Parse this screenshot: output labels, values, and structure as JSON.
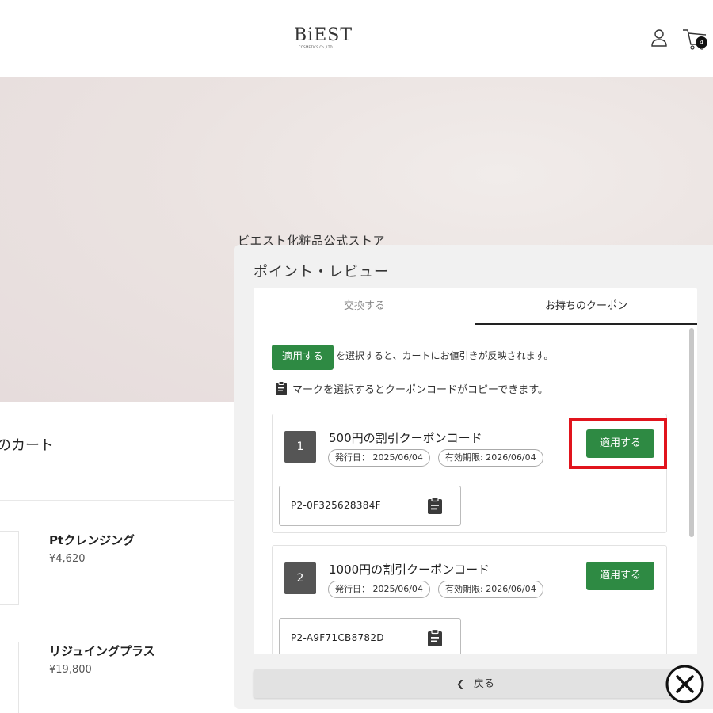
{
  "header": {
    "logo_text": "BiEST",
    "logo_subtext": "COSMETICS Co.,LTD.",
    "cart_count": "4"
  },
  "hero": {
    "shop_title": "ビエスト化粧品公式ストア"
  },
  "cart": {
    "title": "のカート",
    "items": [
      {
        "name": "Ptクレンジング",
        "price": "¥4,620"
      },
      {
        "name": "リジュイングプラス",
        "price": "¥19,800"
      }
    ]
  },
  "panel": {
    "title": "ポイント・レビュー",
    "tabs": [
      {
        "label": "交換する",
        "active": false
      },
      {
        "label": "お持ちのクーポン",
        "active": true
      }
    ],
    "inline_apply_label": "適用する",
    "note_apply": "を選択すると、カートにお値引きが反映されます。",
    "note_copy": "マークを選択するとクーポンコードがコピーできます。",
    "coupons": [
      {
        "number": "1",
        "title": "500円の割引クーポンコード",
        "issued": "発行日： 2025/06/04",
        "expiry": "有効期限: 2026/06/04",
        "apply_label": "適用する",
        "code": "P2-0F325628384F"
      },
      {
        "number": "2",
        "title": "1000円の割引クーポンコード",
        "issued": "発行日： 2025/06/04",
        "expiry": "有効期限: 2026/06/04",
        "apply_label": "適用する",
        "code": "P2-A9F71CB8782D"
      }
    ],
    "back_label": "戻る"
  },
  "colors": {
    "apply_green": "#2e8a43",
    "highlight_red": "#e1141d",
    "number_box": "#555555"
  },
  "icons": [
    "user-icon",
    "cart-icon",
    "clipboard-icon",
    "chevron-left-icon",
    "close-icon"
  ]
}
